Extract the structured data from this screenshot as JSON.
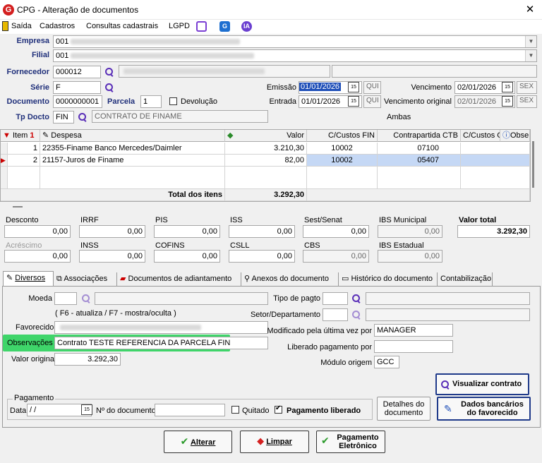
{
  "window": {
    "title": "CPG - Alteração de documentos",
    "close": "✕",
    "logo": "G"
  },
  "menu": {
    "saida": "Saída",
    "cadastros": "Cadastros",
    "consultas": "Consultas cadastrais",
    "lgpd": "LGPD",
    "icons": [
      "chat-icon",
      "g-icon",
      "ia-icon"
    ]
  },
  "header": {
    "empresa_label": "Empresa",
    "empresa_code": "001",
    "filial_label": "Filial",
    "filial_code": "001",
    "fornecedor_label": "Fornecedor",
    "fornecedor_code": "000012",
    "serie_label": "Série",
    "serie_value": "F",
    "documento_label": "Documento",
    "documento_value": "0000000001",
    "parcela_label": "Parcela",
    "parcela_value": "1",
    "devolucao_label": "Devolução",
    "tpdocto_label": "Tp Docto",
    "tpdocto_code": "FIN",
    "tpdocto_desc": "CONTRATO DE FINAME",
    "emissao_label": "Emissão",
    "emissao_value": "01/01/2026",
    "emissao_day": "QUI",
    "entrada_label": "Entrada",
    "entrada_value": "01/01/2026",
    "entrada_day": "QUI",
    "vencimento_label": "Vencimento",
    "vencimento_value": "02/01/2026",
    "vencimento_day": "SEX",
    "vencorig_label": "Vencimento original",
    "vencorig_value": "02/01/2026",
    "vencorig_day": "SEX",
    "ambas": "Ambas"
  },
  "grid": {
    "columns": [
      "Item",
      "Despesa",
      "Valor",
      "C/Custos FIN",
      "Contrapartida CTB",
      "C/Custos CTB",
      "Obse"
    ],
    "rows": [
      {
        "item": "1",
        "despesa": "22355-Finame Banco Mercedes/Daimler",
        "valor": "3.210,30",
        "ccfin": "10002",
        "contra": "07100",
        "ccctb": ""
      },
      {
        "item": "2",
        "despesa": "21157-Juros de Finame",
        "valor": "82,00",
        "ccfin": "10002",
        "contra": "05407",
        "ccctb": ""
      }
    ],
    "total_label": "Total dos itens",
    "total_value": "3.292,30"
  },
  "totals": {
    "desconto_label": "Desconto",
    "desconto": "0,00",
    "irrf_label": "IRRF",
    "irrf": "0,00",
    "pis_label": "PIS",
    "pis": "0,00",
    "iss_label": "ISS",
    "iss": "0,00",
    "sest_label": "Sest/Senat",
    "sest": "0,00",
    "ibsm_label": "IBS Municipal",
    "ibsm": "0,00",
    "vtotal_label": "Valor total",
    "vtotal": "3.292,30",
    "acrescimo_label": "Acréscimo",
    "acrescimo": "0,00",
    "inss_label": "INSS",
    "inss": "0,00",
    "cofins_label": "COFINS",
    "cofins": "0,00",
    "csll_label": "CSLL",
    "csll": "0,00",
    "cbs_label": "CBS",
    "cbs": "0,00",
    "ibse_label": "IBS Estadual",
    "ibse": "0,00"
  },
  "tabs": [
    "Diversos",
    "Associações",
    "Documentos de adiantamento",
    "Anexos do documento",
    "Histórico do documento",
    "Contabilização"
  ],
  "diversos": {
    "moeda_label": "Moeda",
    "f6_hint": "( F6 - atualiza / F7 - mostra/oculta )",
    "favorecido_label": "Favorecido",
    "observacoes_label": "Observações",
    "observacoes_value": "Contrato TESTE REFERENCIA DA PARCELA FIN",
    "valororig_label": "Valor original",
    "valororig_value": "3.292,30",
    "tipopagto_label": "Tipo de pagto",
    "setor_label": "Setor/Departamento",
    "modificado_label": "Modificado pela última vez por",
    "modificado_value": "MANAGER",
    "liberado_label": "Liberado pagamento por",
    "liberado_value": "",
    "modulo_label": "Módulo origem",
    "modulo_value": "GCC",
    "visualizar_label": "Visualizar contrato",
    "pagamento_legend": "Pagamento",
    "data_label": "Data",
    "data_value": " /  /",
    "ndoc_label": "Nº do documento",
    "quitado_label": "Quitado",
    "pagliberado_label": "Pagamento liberado",
    "detalhes_label": "Detalhes do documento",
    "dadosbanc_label": "Dados bancários do favorecido"
  },
  "actions": {
    "alterar": "Alterar",
    "limpar": "Limpar",
    "pagamento": "Pagamento Eletrônico"
  }
}
